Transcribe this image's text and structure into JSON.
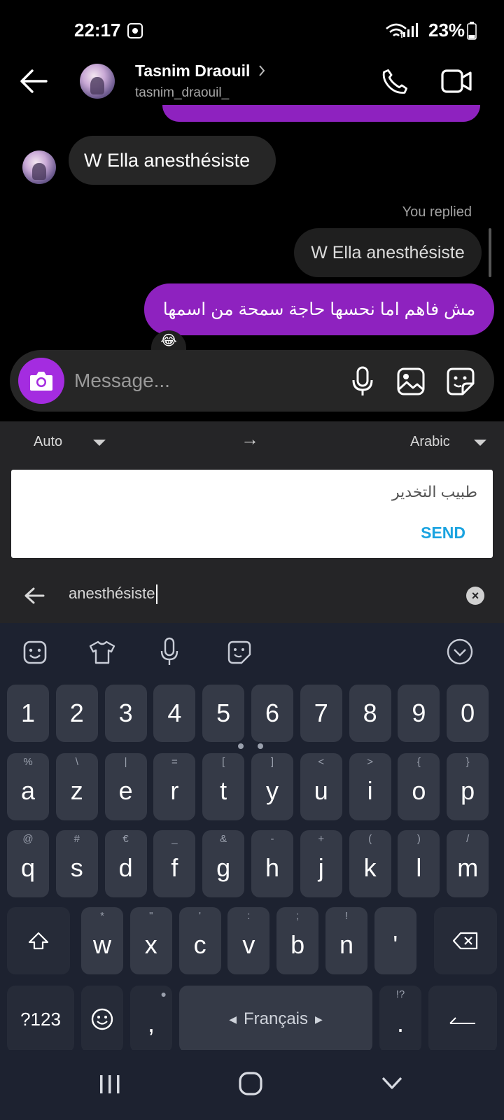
{
  "status_bar": {
    "time": "22:17",
    "battery": "23%"
  },
  "header": {
    "name": "Tasnim Draouil",
    "username": "tasnim_draouil_"
  },
  "messages": {
    "received": "W Ella anesthésiste",
    "replied_label": "You replied",
    "quoted": "W Ella anesthésiste",
    "sent": "مش فاهم اما نحسها حاجة سمحة من اسمها",
    "reaction": "😂"
  },
  "composer": {
    "placeholder": "Message..."
  },
  "translator": {
    "source_lang": "Auto",
    "target_lang": "Arabic",
    "arrow": "→",
    "result": "طبيب التخدير",
    "send_label": "SEND",
    "input_text": "anesthésiste"
  },
  "keyboard": {
    "numbers": [
      "1",
      "2",
      "3",
      "4",
      "5",
      "6",
      "7",
      "8",
      "9",
      "0"
    ],
    "row1": [
      {
        "k": "a",
        "h": "%"
      },
      {
        "k": "z",
        "h": "\\"
      },
      {
        "k": "e",
        "h": "|"
      },
      {
        "k": "r",
        "h": "="
      },
      {
        "k": "t",
        "h": "["
      },
      {
        "k": "y",
        "h": "]"
      },
      {
        "k": "u",
        "h": "<"
      },
      {
        "k": "i",
        "h": ">"
      },
      {
        "k": "o",
        "h": "{"
      },
      {
        "k": "p",
        "h": "}"
      }
    ],
    "row2": [
      {
        "k": "q",
        "h": "@"
      },
      {
        "k": "s",
        "h": "#"
      },
      {
        "k": "d",
        "h": "€"
      },
      {
        "k": "f",
        "h": "_"
      },
      {
        "k": "g",
        "h": "&"
      },
      {
        "k": "h",
        "h": "-"
      },
      {
        "k": "j",
        "h": "+"
      },
      {
        "k": "k",
        "h": "("
      },
      {
        "k": "l",
        "h": ")"
      },
      {
        "k": "m",
        "h": "/"
      }
    ],
    "row3": [
      {
        "k": "w",
        "h": "*"
      },
      {
        "k": "x",
        "h": "\""
      },
      {
        "k": "c",
        "h": "'"
      },
      {
        "k": "v",
        "h": ":"
      },
      {
        "k": "b",
        "h": ";"
      },
      {
        "k": "n",
        "h": "!"
      },
      {
        "k": "'",
        "h": ""
      }
    ],
    "symbols_label": "?123",
    "comma": ",",
    "space_label": "Français",
    "period": ".",
    "period_hint": "!?"
  }
}
